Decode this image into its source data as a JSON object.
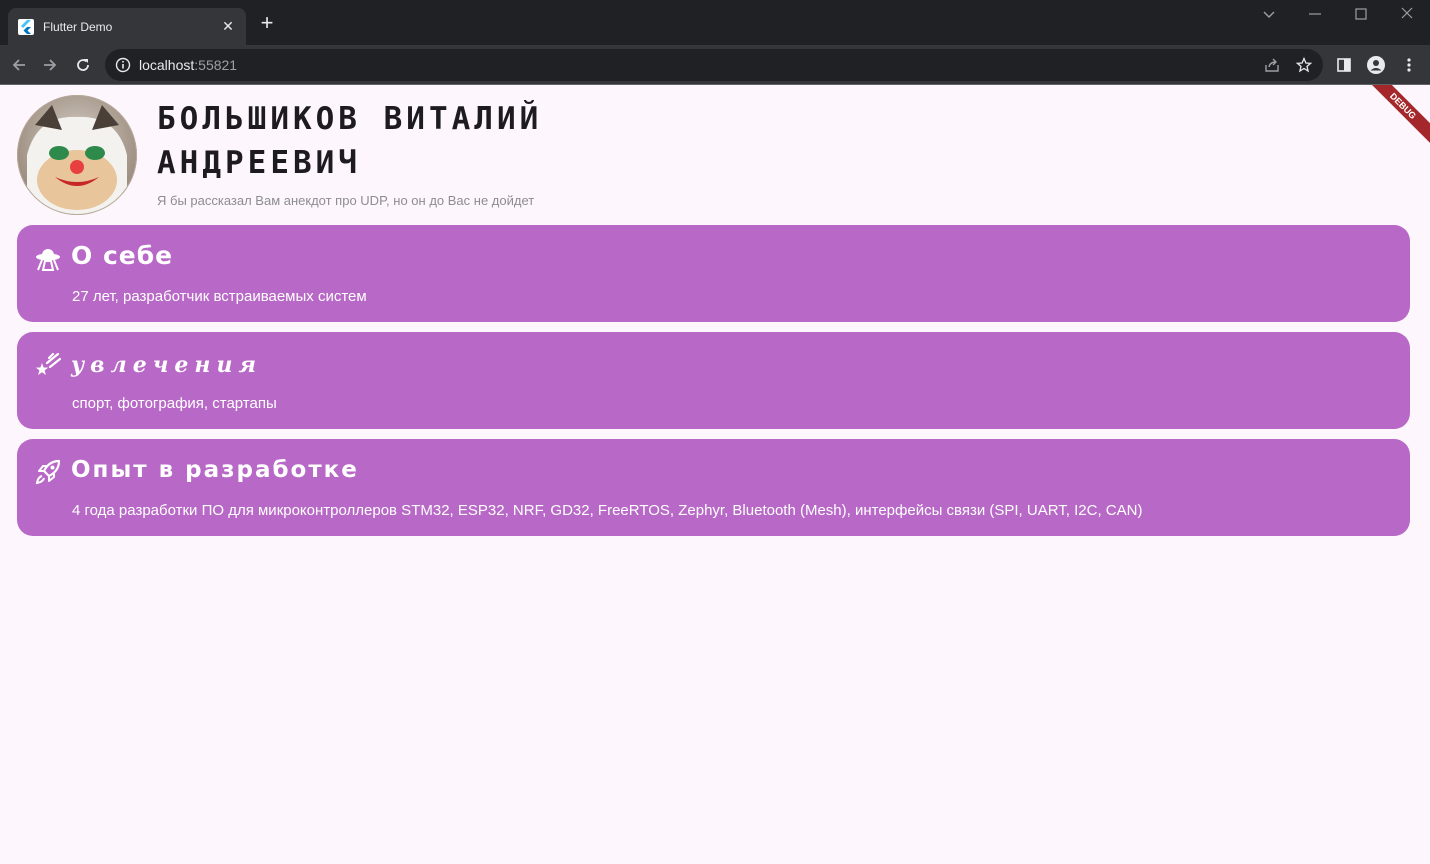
{
  "browser": {
    "tab_title": "Flutter Demo",
    "url_host": "localhost",
    "url_port": ":55821"
  },
  "profile": {
    "name": "Большиков Виталий Андреевич",
    "quote": "Я бы рассказал Вам анекдот про UDP, но он до Вас не дойдет"
  },
  "cards": [
    {
      "icon": "ufo-icon",
      "title": "О себе",
      "text": "27 лет, разработчик встраиваемых систем"
    },
    {
      "icon": "shooting-stars-icon",
      "title": "увлечения",
      "text": "спорт, фотография, стартапы"
    },
    {
      "icon": "rocket-icon",
      "title": "Опыт в разработке",
      "text": "4 года разработки ПО для микроконтроллеров STM32, ESP32, NRF, GD32, FreeRTOS, Zephyr, Bluetooth (Mesh), интерфейсы связи (SPI, UART, I2C, CAN)"
    }
  ],
  "debug_banner": "DEBUG",
  "colors": {
    "card": "#b868c6",
    "background": "#fdf7fd",
    "debug": "#a4282b"
  }
}
